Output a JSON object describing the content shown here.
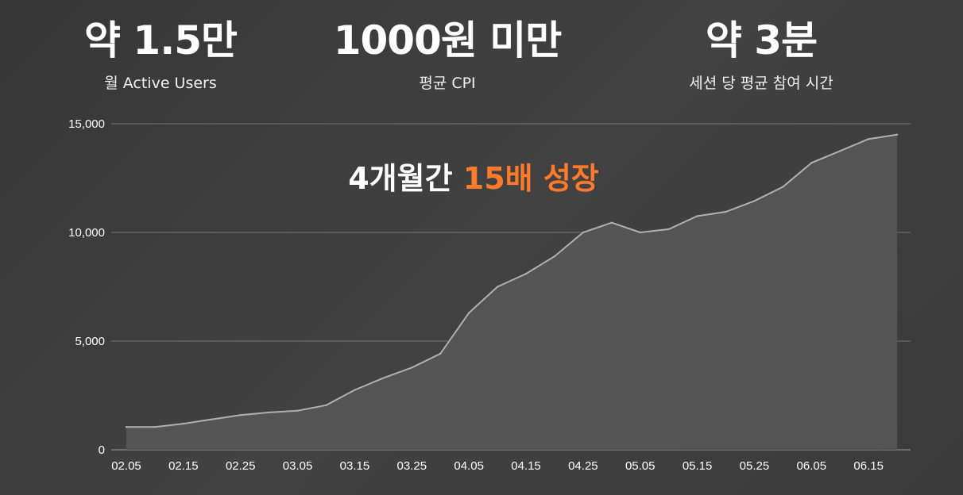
{
  "stats": [
    {
      "value": "약 1.5만",
      "label": "월 Active Users"
    },
    {
      "value": "1000원 미만",
      "label": "평균 CPI"
    },
    {
      "value": "약 3분",
      "label": "세션 당 평균 참여 시간"
    }
  ],
  "headline": {
    "prefix": "4개월간 ",
    "highlight": "15배 성장"
  },
  "colors": {
    "highlight": "#ff7a2a",
    "line": "#b0b0b0",
    "area": "#545454",
    "grid": "#8a8a8a"
  },
  "chart_data": {
    "type": "area",
    "title": "",
    "xlabel": "",
    "ylabel": "",
    "ylim": [
      0,
      15000
    ],
    "grid": true,
    "y_ticks": [
      "0",
      "5,000",
      "10,000",
      "15,000"
    ],
    "x_tick_labels": [
      "02.05",
      "02.15",
      "02.25",
      "03.05",
      "03.15",
      "03.25",
      "04.05",
      "04.15",
      "04.25",
      "05.05",
      "05.15",
      "05.25",
      "06.05",
      "06.15"
    ],
    "x": [
      "02.05",
      "02.10",
      "02.15",
      "02.20",
      "02.25",
      "03.01",
      "03.05",
      "03.10",
      "03.15",
      "03.20",
      "03.25",
      "03.30",
      "04.05",
      "04.10",
      "04.15",
      "04.20",
      "04.25",
      "04.30",
      "05.05",
      "05.10",
      "05.15",
      "05.20",
      "05.25",
      "05.30",
      "06.05",
      "06.10",
      "06.15",
      "06.20"
    ],
    "series": [
      {
        "values": [
          1050,
          1050,
          1200,
          1400,
          1600,
          1720,
          1800,
          2050,
          2750,
          3300,
          3780,
          4420,
          6300,
          7500,
          8100,
          8900,
          10000,
          10450,
          10000,
          10150,
          10750,
          10950,
          11450,
          12100,
          13200,
          13750,
          14300,
          14500
        ]
      }
    ]
  }
}
